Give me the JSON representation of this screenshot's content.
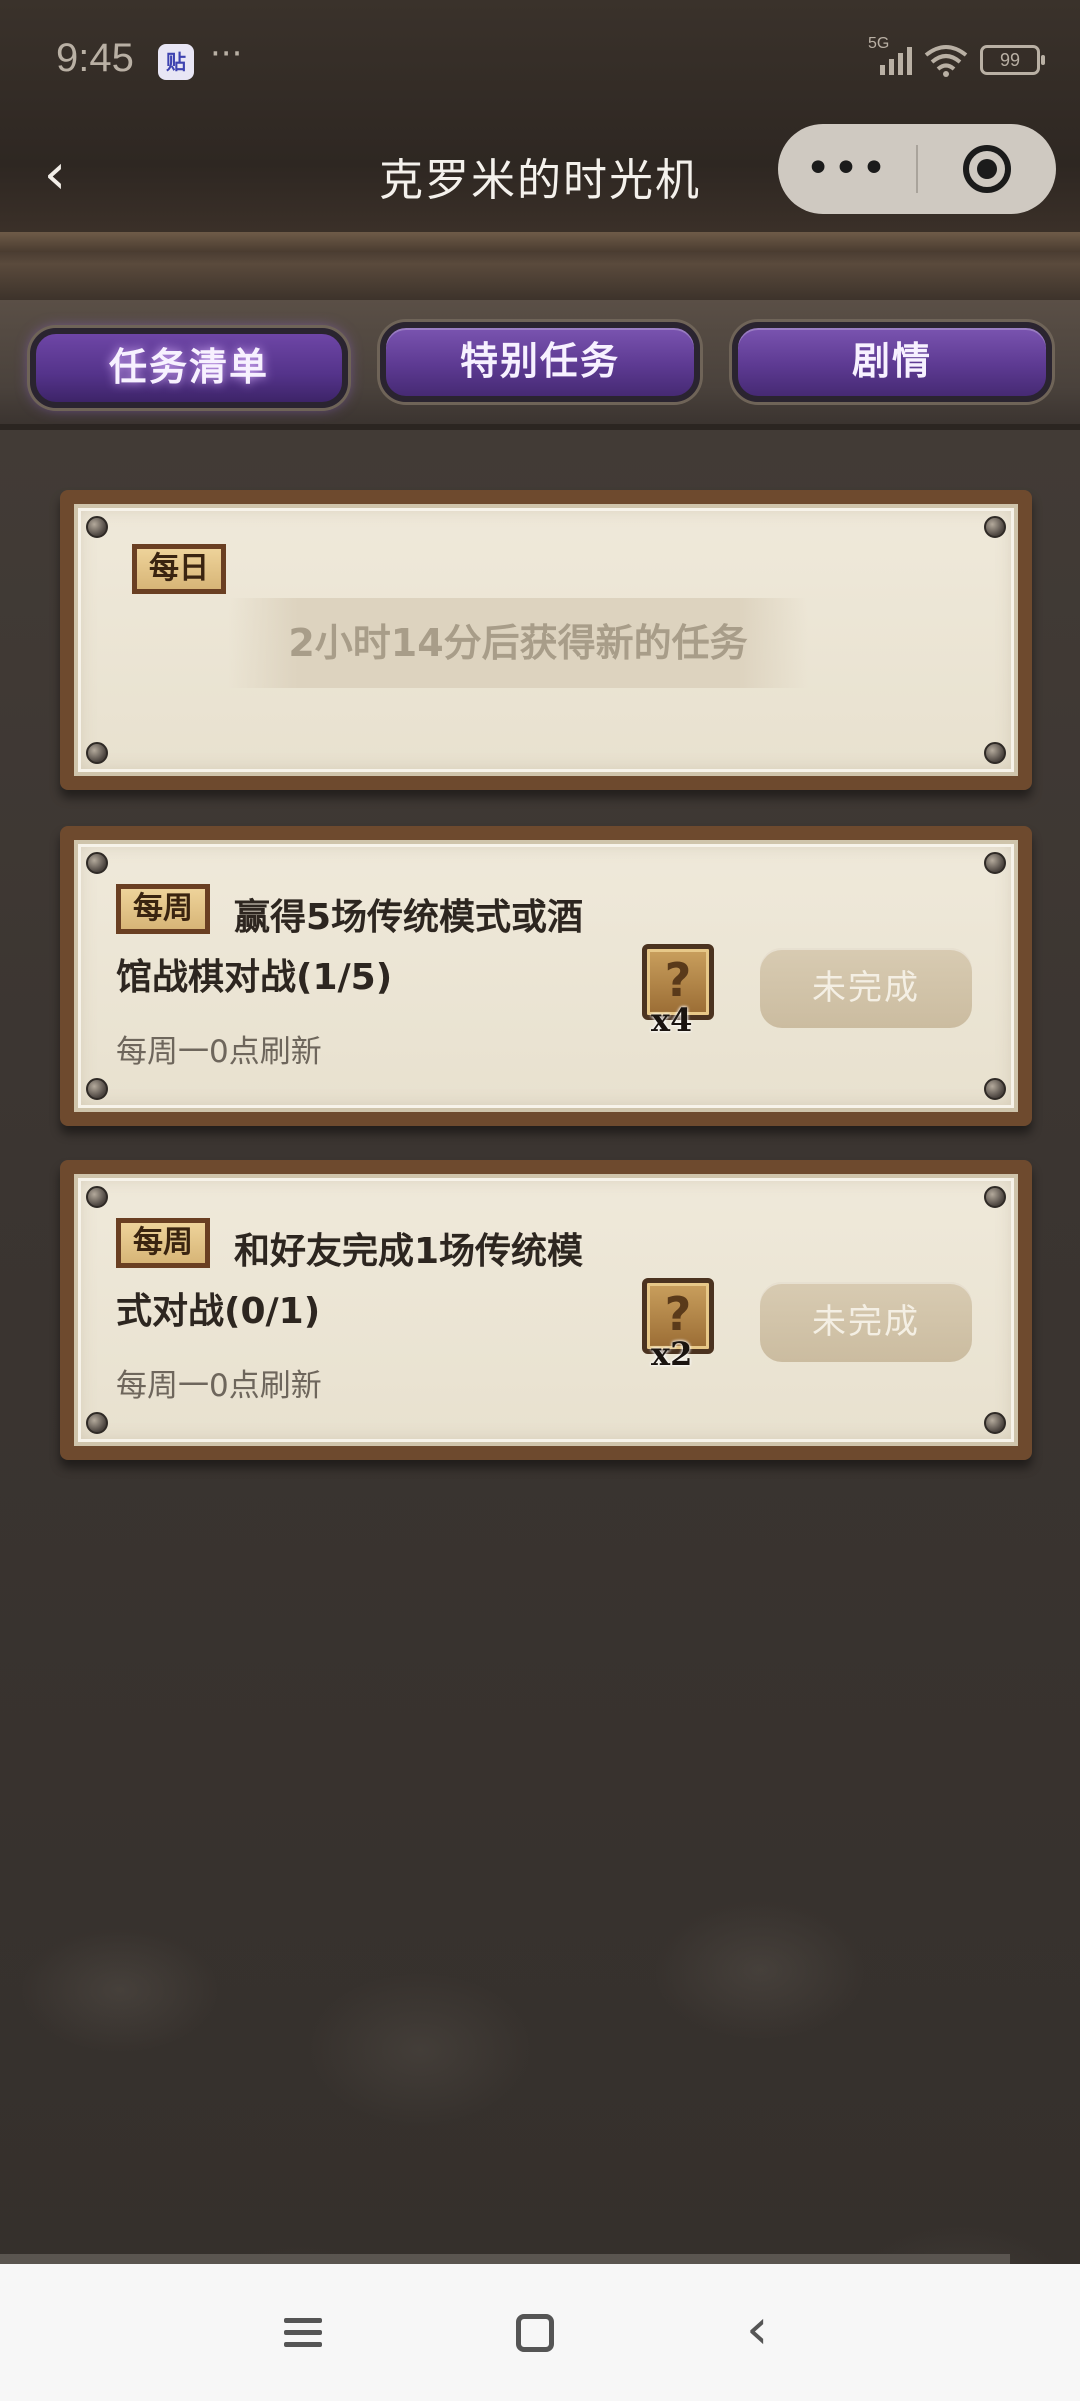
{
  "status_bar": {
    "time": "9:45",
    "app_badge": "贴",
    "more": "···",
    "network": "5G",
    "battery": "99"
  },
  "nav": {
    "back_icon": "‹",
    "title": "克罗米的时光机",
    "more_label": "•••"
  },
  "tabs": [
    {
      "label": "任务清单",
      "active": true
    },
    {
      "label": "特别任务",
      "active": false
    },
    {
      "label": "剧情",
      "active": false
    }
  ],
  "daily_card": {
    "tag": "每日",
    "countdown": "2小时14分后获得新的任务"
  },
  "weekly_tasks": [
    {
      "tag": "每周",
      "text_line1": "赢得5场传统模式或酒",
      "text_line2": "馆战棋对战(1/5)",
      "refresh": "每周一0点刷新",
      "reward_glyph": "?",
      "reward_qty": "x4",
      "status": "未完成"
    },
    {
      "tag": "每周",
      "text_line1": "和好友完成1场传统模",
      "text_line2": "式对战(0/1)",
      "refresh": "每周一0点刷新",
      "reward_glyph": "?",
      "reward_qty": "x2",
      "status": "未完成"
    }
  ],
  "system_nav": {
    "icons": [
      "menu-icon",
      "home-icon",
      "back-icon"
    ]
  }
}
